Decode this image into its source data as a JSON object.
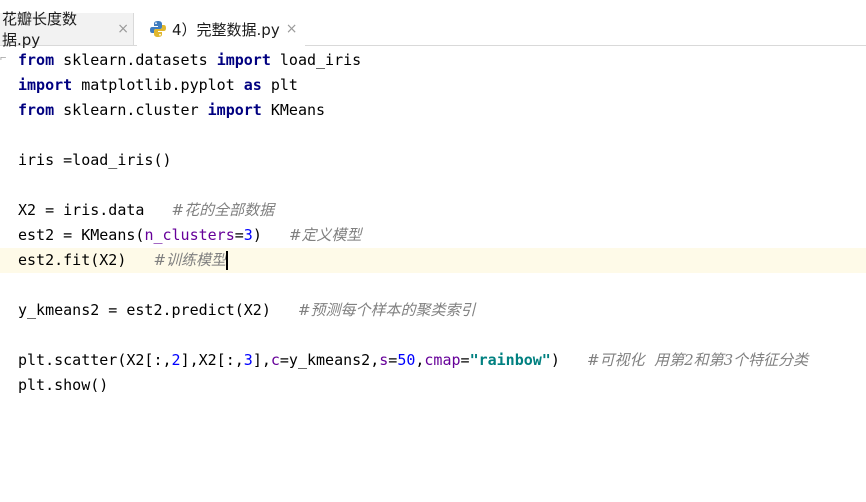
{
  "tabs": [
    {
      "label": "花瓣长度数据.py",
      "close": "×",
      "active": false
    },
    {
      "label": "4）完整数据.py",
      "close": "×",
      "active": true
    }
  ],
  "code": {
    "line1": {
      "kw1": "from",
      "mid": " sklearn.datasets ",
      "kw2": "import",
      "rest": " load_iris"
    },
    "line2": {
      "kw1": "import",
      "mid": " matplotlib.pyplot ",
      "kw2": "as",
      "rest": " plt"
    },
    "line3": {
      "kw1": "from",
      "mid": " sklearn.cluster ",
      "kw2": "import",
      "rest": " KMeans"
    },
    "line5": {
      "text": "iris =load_iris()"
    },
    "line7": {
      "text": "X2 = iris.data   ",
      "comment": "#花的全部数据"
    },
    "line8": {
      "pre": "est2 = KMeans(",
      "param": "n_clusters",
      "eq": "=",
      "num": "3",
      "post": ")   ",
      "comment": "#定义模型"
    },
    "line9": {
      "text": "est2.fit(X2)   ",
      "comment": "#训练模型"
    },
    "line11": {
      "text": "y_kmeans2 = est2.predict(X2)   ",
      "comment": "#预测每个样本的聚类索引"
    },
    "line13": {
      "a": "plt.scatter(X2[:,",
      "n1": "2",
      "b": "],X2[:,",
      "n2": "3",
      "c": "],",
      "p1": "c",
      "d": "=y_kmeans2,",
      "p2": "s",
      "e": "=",
      "n3": "50",
      "f": ",",
      "p3": "cmap",
      "g": "=",
      "s1": "\"rainbow\"",
      "h": ")   ",
      "comment": "#可视化  用第2和第3个特征分类"
    },
    "line14": {
      "text": "plt.show()"
    }
  },
  "colors": {
    "keyword": "#000080",
    "param": "#660099",
    "number": "#0000ff",
    "string": "#008080",
    "comment": "#808080",
    "current_line": "#fefae8"
  },
  "icons": {
    "python_file": "python-file-icon",
    "fold": "fold-marker-icon",
    "close": "close-icon"
  }
}
